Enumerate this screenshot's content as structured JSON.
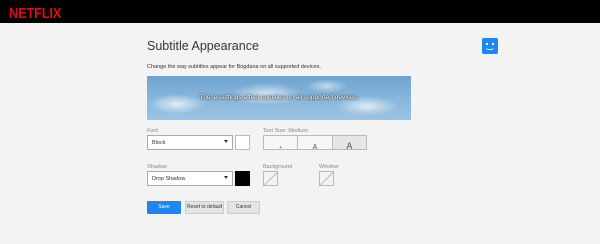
{
  "header": {
    "logo_text": "NETFLIX",
    "brand_color": "#e50914"
  },
  "page": {
    "title": "Subtitle Appearance",
    "description": "Change the way subtitles appear for Bogdana on all supported devices.",
    "avatar_icon": "smiley-profile-icon",
    "avatar_color": "#1e86f0"
  },
  "preview": {
    "text": "These settings affect subtitles on all supported devices."
  },
  "font": {
    "label": "Font",
    "value": "Block",
    "color": "#ffffff"
  },
  "text_size": {
    "label": "Text Size: Medium",
    "options": [
      "+",
      "A",
      "A"
    ],
    "selected_index": 2
  },
  "shadow": {
    "label": "Shadow",
    "value": "Drop Shadow",
    "color": "#000000"
  },
  "background": {
    "label": "Background",
    "color": "none"
  },
  "window": {
    "label": "Window",
    "color": "none"
  },
  "actions": {
    "save": "Save",
    "reset": "Reset to default",
    "cancel": "Cancel"
  }
}
